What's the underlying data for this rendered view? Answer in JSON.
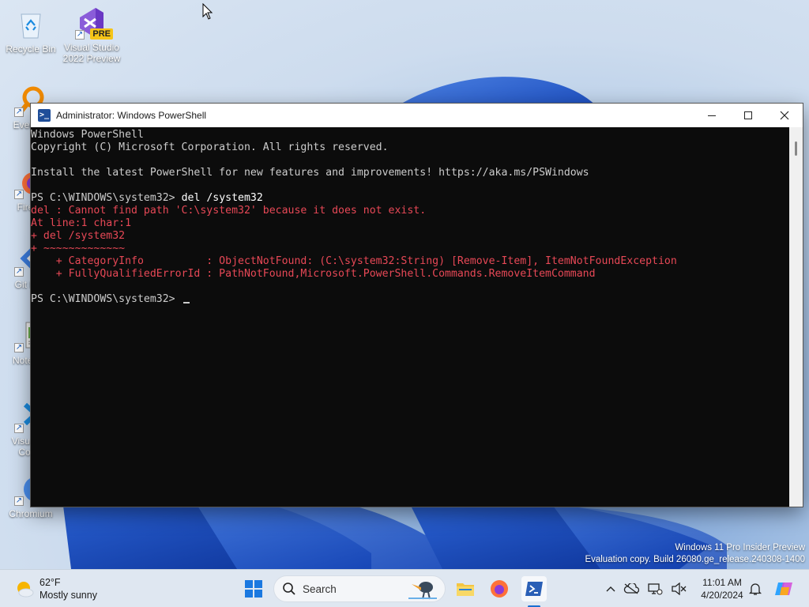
{
  "desktop": {
    "icons": [
      {
        "label": "Recycle Bin"
      },
      {
        "label": "Visual Studio 2022 Preview",
        "badge": "PRE"
      },
      {
        "label": "Every"
      },
      {
        "label": "Fire"
      },
      {
        "label": "Git B"
      },
      {
        "label": "Notep"
      },
      {
        "label": "Visual\nCo"
      },
      {
        "label": "Chromium"
      }
    ],
    "watermark": {
      "line1": "Windows 11 Pro Insider Preview",
      "line2": "Evaluation copy. Build 26080.ge_release.240308-1400"
    }
  },
  "window": {
    "title": "Administrator: Windows PowerShell",
    "icon": "powershell-icon",
    "console_lines": [
      {
        "text": "Windows PowerShell",
        "style": "normal"
      },
      {
        "text": "Copyright (C) Microsoft Corporation. All rights reserved.",
        "style": "normal"
      },
      {
        "text": "",
        "style": "normal"
      },
      {
        "text": "Install the latest PowerShell for new features and improvements! https://aka.ms/PSWindows",
        "style": "normal"
      },
      {
        "text": "",
        "style": "normal"
      },
      {
        "prompt": "PS C:\\WINDOWS\\system32> ",
        "command": "del /system32",
        "style": "prompt"
      },
      {
        "text": "del : Cannot find path 'C:\\system32' because it does not exist.",
        "style": "err"
      },
      {
        "text": "At line:1 char:1",
        "style": "err"
      },
      {
        "text": "+ del /system32",
        "style": "err"
      },
      {
        "text": "+ ~~~~~~~~~~~~~",
        "style": "err"
      },
      {
        "text": "    + CategoryInfo          : ObjectNotFound: (C:\\system32:String) [Remove-Item], ItemNotFoundException",
        "style": "err"
      },
      {
        "text": "    + FullyQualifiedErrorId : PathNotFound,Microsoft.PowerShell.Commands.RemoveItemCommand",
        "style": "err"
      },
      {
        "text": "",
        "style": "normal"
      },
      {
        "prompt": "PS C:\\WINDOWS\\system32> ",
        "command": "",
        "style": "prompt",
        "cursor": true
      }
    ]
  },
  "taskbar": {
    "weather": {
      "temp": "62°F",
      "condition": "Mostly sunny"
    },
    "search": {
      "placeholder": "Search"
    },
    "clock": {
      "time": "11:01 AM",
      "date": "4/20/2024"
    }
  },
  "colors": {
    "console_bg": "#0c0c0c",
    "console_fg": "#cccccc",
    "error_fg": "#e74856",
    "accent": "#1a6fd1"
  }
}
